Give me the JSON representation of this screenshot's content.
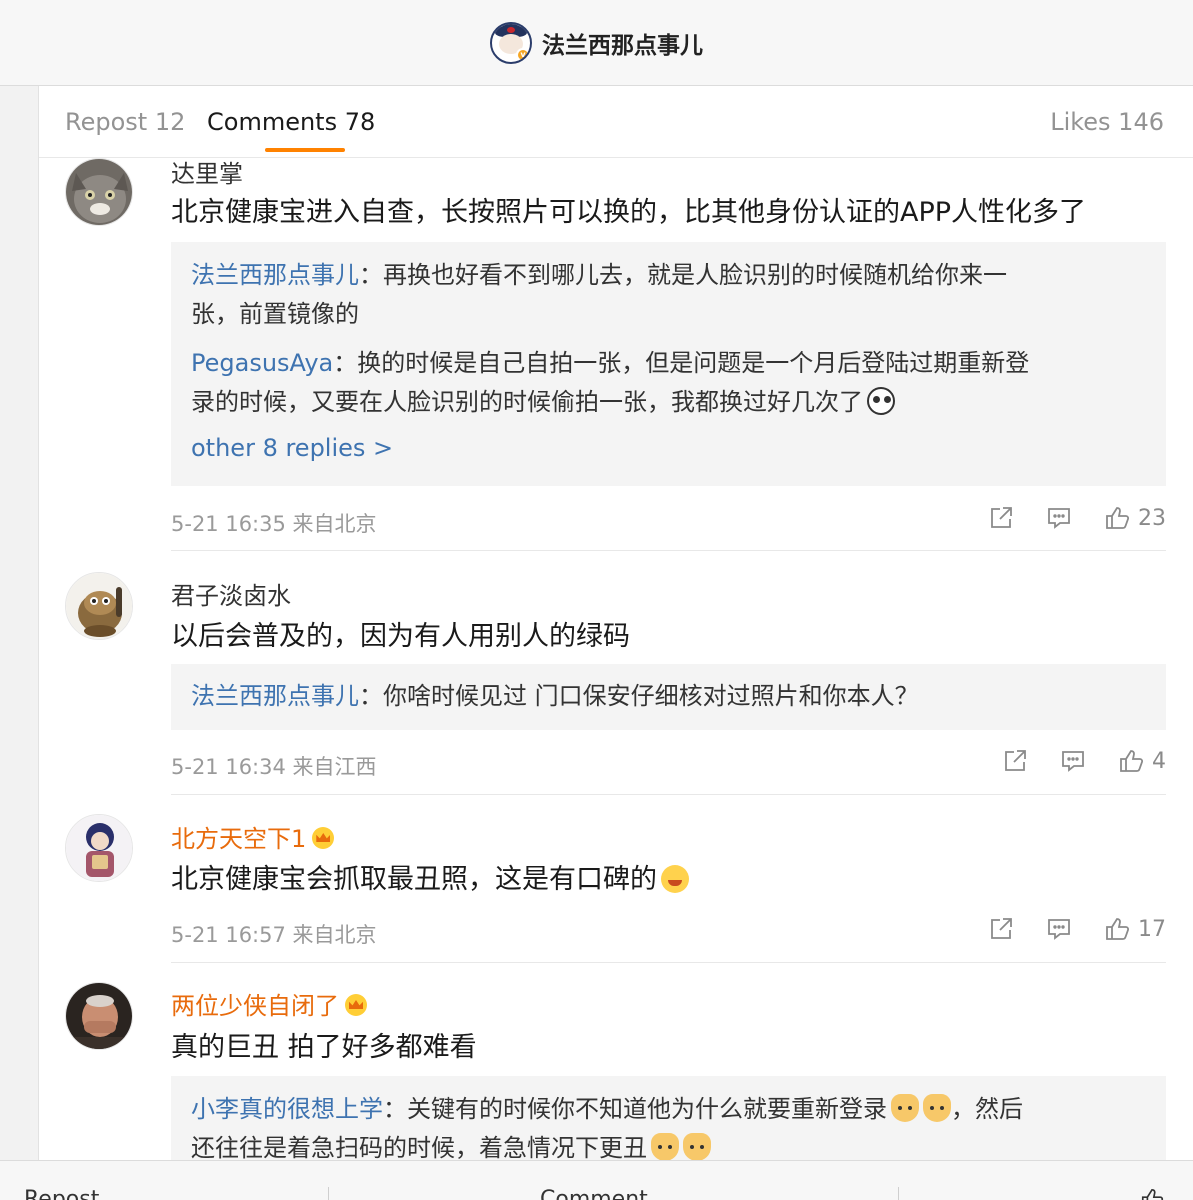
{
  "header": {
    "account_name": "法兰西那点事儿"
  },
  "tabs": {
    "repost": "Repost 12",
    "comments": "Comments 78",
    "likes": "Likes 146"
  },
  "comments": [
    {
      "name": "达里掌",
      "text": "北京健康宝进入自查，长按照片可以换的，比其他身份认证的APP人性化多了",
      "replies": [
        {
          "name": "法兰西那点事儿",
          "line1": "：再换也好看不到哪儿去，就是人脸识别的时候随机给你来一",
          "line2": "张，前置镜像的"
        },
        {
          "name": "PegasusAya",
          "line1": "：换的时候是自己自拍一张，但是问题是一个月后登陆过期重新登",
          "line2": "录的时候，又要在人脸识别的时候偷拍一张，我都换过好几次了"
        }
      ],
      "more": "other 8 replies >",
      "time": "5-21 16:35 来自北京",
      "likes": "23"
    },
    {
      "name": "君子淡卤水",
      "text": "以后会普及的，因为有人用别人的绿码",
      "replies": [
        {
          "name": "法兰西那点事儿",
          "line1": "：你啥时候见过 门口保安仔细核对过照片和你本人？"
        }
      ],
      "time": "5-21 16:34 来自江西",
      "likes": "4"
    },
    {
      "name": "北方天空下1",
      "text": "北京健康宝会抓取最丑照，这是有口碑的",
      "time": "5-21 16:57 来自北京",
      "likes": "17"
    },
    {
      "name": "两位少侠自闭了",
      "text": "真的巨丑 拍了好多都难看",
      "replies": [
        {
          "name": "小李真的很想上学",
          "line1": "：关键有的时候你不知道他为什么就要重新登录",
          "line1_tail": "，然后",
          "line2": "还往往是着急扫码的时候，着急情况下更丑"
        }
      ]
    }
  ],
  "bottom_bar": {
    "repost": "Repost",
    "comment": "Comment"
  }
}
